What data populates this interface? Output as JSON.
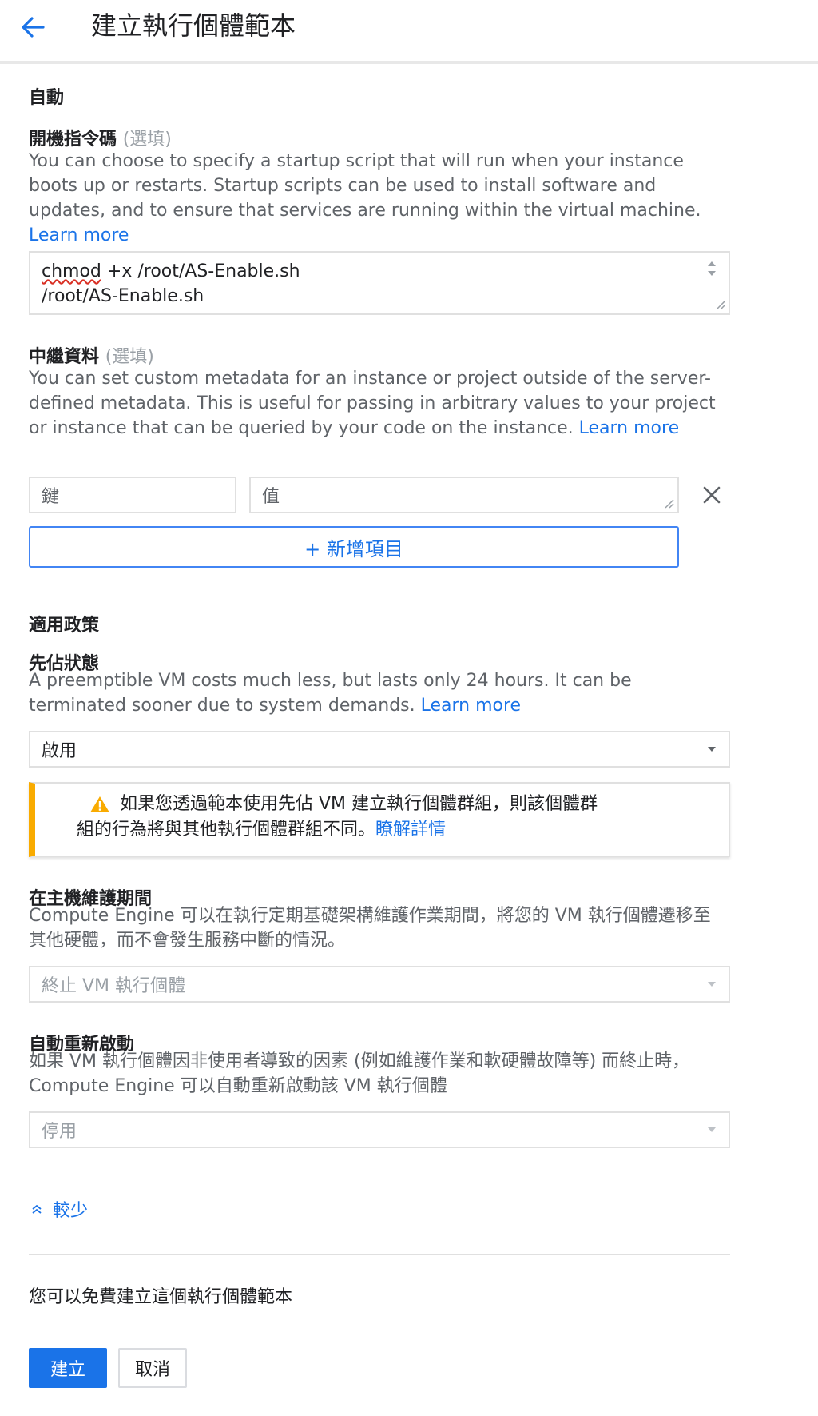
{
  "header": {
    "title": "建立執行個體範本"
  },
  "automation": {
    "section_title": "自動",
    "startup_label": "開機指令碼",
    "startup_optional": "(選填)",
    "startup_help": "You can choose to specify a startup script that will run when your instance boots up or restarts. Startup scripts can be used to install software and updates, and to ensure that services are running within the virtual machine.",
    "learn_more": "Learn more",
    "script_line1_word": "chmod",
    "script_line1_rest": " +x /root/AS-Enable.sh",
    "script_line2": "/root/AS-Enable.sh"
  },
  "metadata": {
    "label": "中繼資料",
    "optional": "(選填)",
    "help": "You can set custom metadata for an instance or project outside of the server-defined metadata. This is useful for passing in arbitrary values to your project or instance that can be queried by your code on the instance.",
    "learn_more": "Learn more",
    "key_placeholder": "鍵",
    "value_placeholder": "值",
    "add_item": "+ 新增項目"
  },
  "availability": {
    "section_title": "適用政策",
    "preempt_label": "先佔狀態",
    "preempt_help": "A preemptible VM costs much less, but lasts only 24 hours. It can be terminated sooner due to system demands.",
    "learn_more": "Learn more",
    "preempt_value": "啟用",
    "warning_line1": "如果您透過範本使用先佔 VM 建立執行個體群組，則該個體群",
    "warning_line2": "組的行為將與其他執行個體群組不同。",
    "warning_link": "瞭解詳情",
    "maintenance_label": "在主機維護期間",
    "maintenance_help": "Compute Engine 可以在執行定期基礎架構維護作業期間，將您的 VM 執行個體遷移至其他硬體，而不會發生服務中斷的情況。",
    "maintenance_value": "終止 VM 執行個體",
    "restart_label": "自動重新啟動",
    "restart_help": "如果 VM 執行個體因非使用者導致的因素 (例如維護作業和軟硬體故障等) 而終止時，Compute Engine 可以自動重新啟動該 VM 執行個體",
    "restart_value": "停用"
  },
  "less_toggle": "較少",
  "footer": {
    "free_note": "您可以免費建立這個執行個體範本",
    "create": "建立",
    "cancel": "取消"
  },
  "colors": {
    "accent": "#1a73e8",
    "warning": "#f9ab00"
  }
}
